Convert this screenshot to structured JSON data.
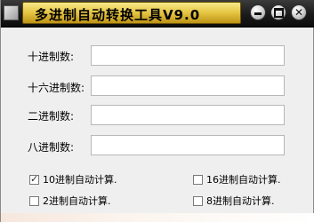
{
  "window": {
    "title": "多进制自动转换工具V9.0"
  },
  "fields": [
    {
      "label": "十进制数:",
      "value": ""
    },
    {
      "label": "十六进制数:",
      "value": ""
    },
    {
      "label": "二进制数:",
      "value": ""
    },
    {
      "label": "八进制数:",
      "value": ""
    }
  ],
  "options": [
    {
      "label": "10进制自动计算.",
      "checked": true
    },
    {
      "label": "16进制自动计算.",
      "checked": false
    },
    {
      "label": "2进制自动计算.",
      "checked": false
    },
    {
      "label": "8进制自动计算.",
      "checked": false
    }
  ],
  "icons": {
    "app": "app-icon",
    "minimize": "minimize-icon",
    "maximize": "maximize-icon",
    "close": "close-icon"
  }
}
